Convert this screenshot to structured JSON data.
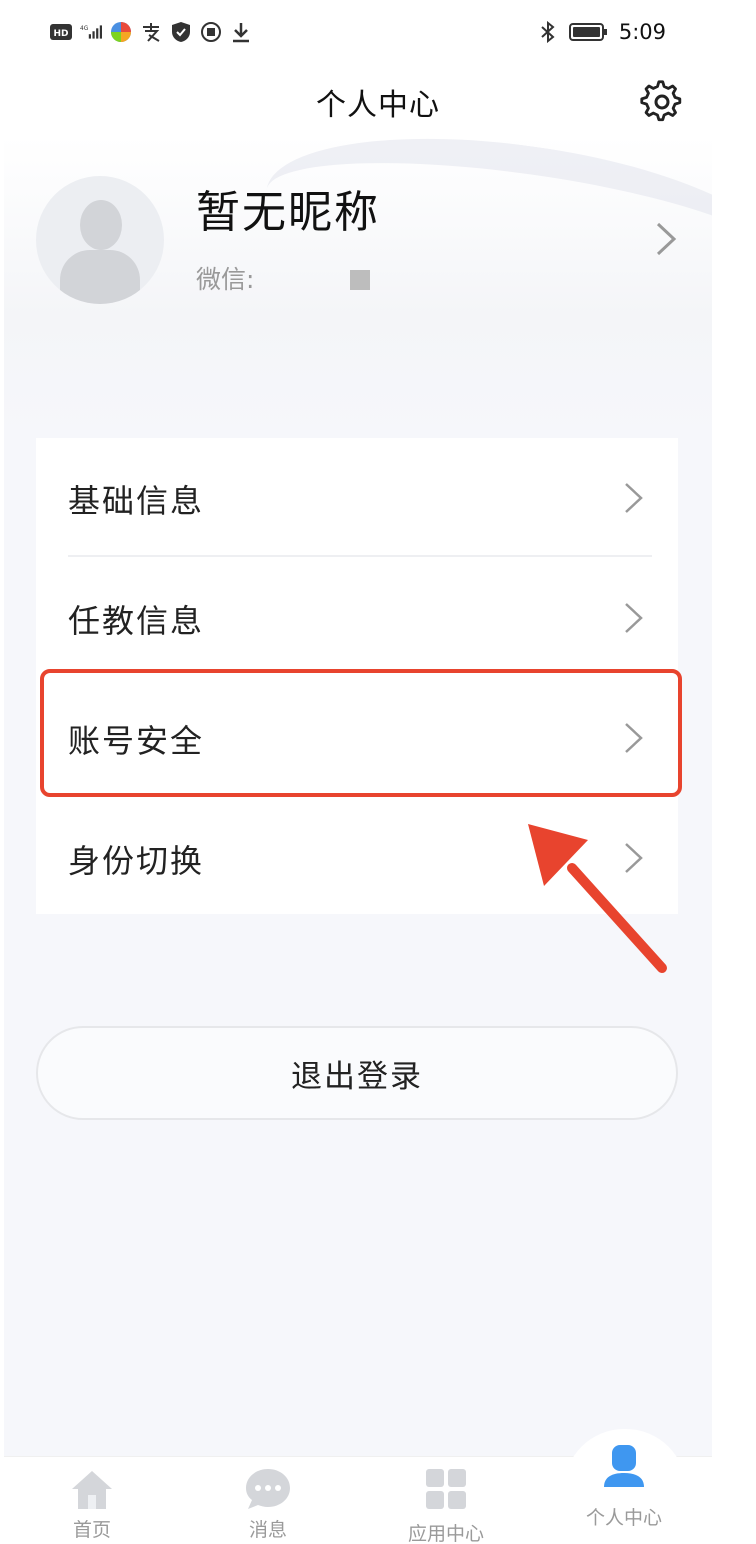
{
  "status_bar": {
    "time": "5:09",
    "icons_left": [
      "hd-icon",
      "signal-icon",
      "app-icon",
      "alipay-icon",
      "shield-icon",
      "app-icon",
      "download-icon"
    ],
    "icons_right": [
      "bluetooth-icon",
      "battery-icon"
    ]
  },
  "header": {
    "title": "个人中心",
    "settings_icon": "gear-icon"
  },
  "profile": {
    "nickname": "暂无昵称",
    "wechat_label": "微信:"
  },
  "menu": {
    "items": [
      {
        "label": "基础信息"
      },
      {
        "label": "任教信息"
      },
      {
        "label": "账号安全"
      },
      {
        "label": "身份切换"
      }
    ]
  },
  "logout": {
    "label": "退出登录"
  },
  "tabbar": {
    "items": [
      {
        "label": "首页",
        "icon": "home-icon"
      },
      {
        "label": "消息",
        "icon": "message-icon"
      },
      {
        "label": "应用中心",
        "icon": "apps-icon"
      },
      {
        "label": "个人中心",
        "icon": "user-icon"
      }
    ],
    "active_color": "#3f97f0",
    "inactive_color": "#d4d6da"
  },
  "annotation_color": "#e8442e"
}
